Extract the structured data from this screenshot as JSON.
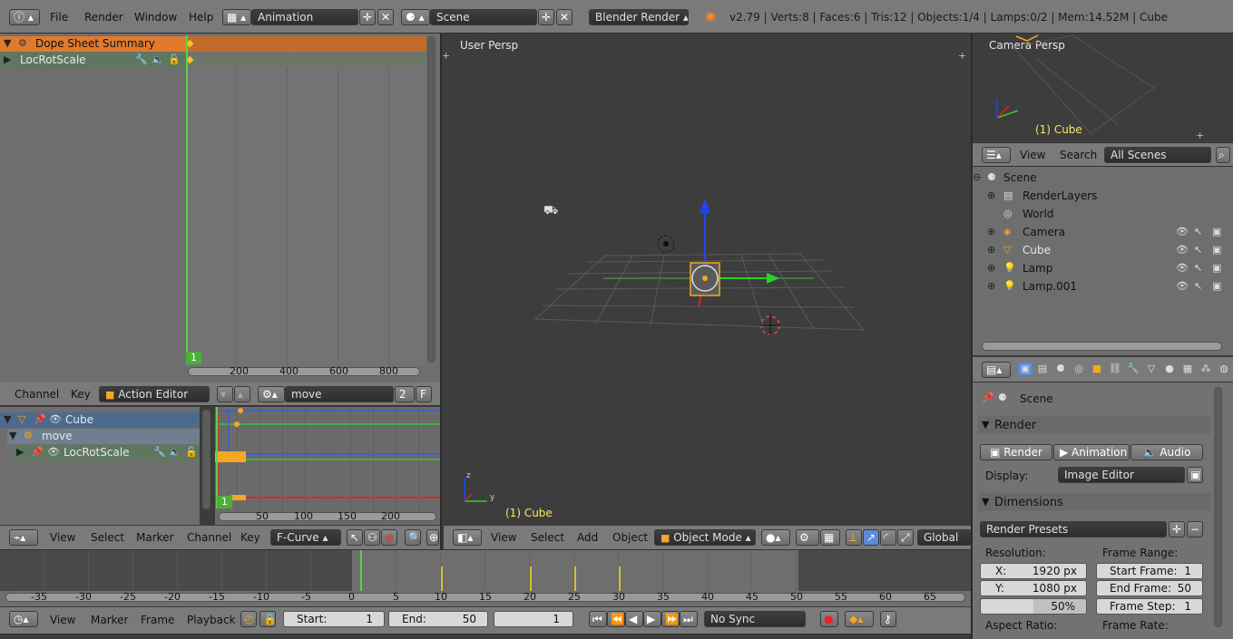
{
  "topbar": {
    "menu": [
      "File",
      "Render",
      "Window",
      "Help"
    ],
    "layout": "Animation",
    "scene": "Scene",
    "engine": "Blender Render",
    "stats": "v2.79 | Verts:8 | Faces:6 | Tris:12 | Objects:1/4 | Lamps:0/2 | Mem:14.52M | Cube"
  },
  "dopesheet_top": {
    "summary": "Dope Sheet Summary",
    "action": "LocRotScale",
    "frame": "1",
    "ticks": [
      "200",
      "400",
      "600",
      "800"
    ]
  },
  "action_editor_header": {
    "menu": [
      "Channel",
      "Key"
    ],
    "mode": "Action Editor",
    "action_name": "move",
    "users": "2",
    "fake": "F"
  },
  "graph_channels": {
    "object": "Cube",
    "action": "move",
    "group": "LocRotScale",
    "frame": "1",
    "ticks": [
      "50",
      "100",
      "150",
      "200"
    ]
  },
  "graph_header": {
    "menu": [
      "View",
      "Select",
      "Marker",
      "Channel",
      "Key"
    ],
    "mode": "F-Curve"
  },
  "viewport": {
    "label": "User Persp",
    "object": "(1) Cube",
    "menu": [
      "View",
      "Select",
      "Add",
      "Object"
    ],
    "mode": "Object Mode",
    "orientation": "Global"
  },
  "camera_view": {
    "label": "Camera Persp",
    "object": "(1) Cube"
  },
  "outliner": {
    "menu": [
      "View",
      "Search"
    ],
    "filter": "All Scenes",
    "items": [
      {
        "label": "Scene",
        "level": 0
      },
      {
        "label": "RenderLayers",
        "level": 1
      },
      {
        "label": "World",
        "level": 1
      },
      {
        "label": "Camera",
        "level": 1
      },
      {
        "label": "Cube",
        "level": 1
      },
      {
        "label": "Lamp",
        "level": 1
      },
      {
        "label": "Lamp.001",
        "level": 1
      }
    ]
  },
  "properties": {
    "context": "Scene",
    "render_panel": "Render",
    "render_buttons": [
      "Render",
      "Animation",
      "Audio"
    ],
    "display_label": "Display:",
    "display_value": "Image Editor",
    "dimensions_panel": "Dimensions",
    "presets": "Render Presets",
    "resolution_label": "Resolution:",
    "res_x": "X:",
    "res_x_val": "1920 px",
    "res_y": "Y:",
    "res_y_val": "1080 px",
    "res_pct": "50%",
    "frame_range_label": "Frame Range:",
    "start_frame": "Start Frame:",
    "start_frame_val": "1",
    "end_frame": "End Frame:",
    "end_frame_val": "50",
    "frame_step": "Frame Step:",
    "frame_step_val": "1",
    "aspect_label": "Aspect Ratio:",
    "frame_rate_label": "Frame Rate:"
  },
  "timeline": {
    "ticks": [
      "-35",
      "-30",
      "-25",
      "-20",
      "-15",
      "-10",
      "-5",
      "0",
      "5",
      "10",
      "15",
      "20",
      "25",
      "30",
      "35",
      "40",
      "45",
      "50",
      "55",
      "60",
      "65"
    ],
    "menu": [
      "View",
      "Marker",
      "Frame",
      "Playback"
    ],
    "start_label": "Start:",
    "start_val": "1",
    "end_label": "End:",
    "end_val": "50",
    "current": "1",
    "sync": "No Sync"
  },
  "colors": {
    "accent": "#f5a623",
    "selected_row": "#d7762b",
    "action_row": "#6a7a66",
    "playhead": "#5cd34a"
  }
}
